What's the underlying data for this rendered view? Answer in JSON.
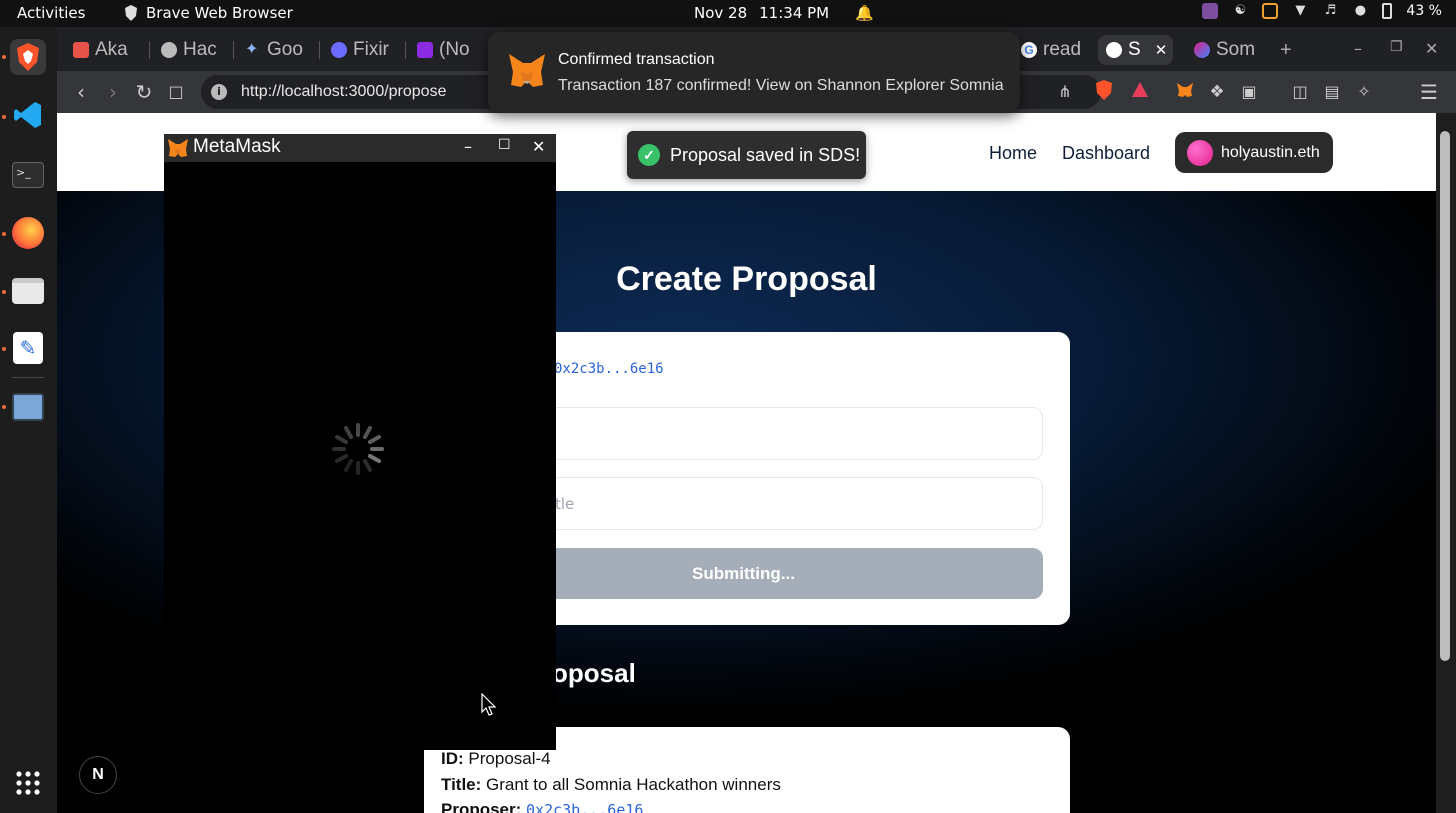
{
  "system": {
    "activities_label": "Activities",
    "app_name": "Brave Web Browser",
    "date": "Nov 28",
    "time": "11:34 PM",
    "battery": "43 %"
  },
  "browser": {
    "tabs": [
      {
        "label": "Aka",
        "favicon_color": "#e5534b"
      },
      {
        "label": "Hac",
        "favicon_color": "#bbbbbb"
      },
      {
        "label": "Goo",
        "favicon_color": "#8ab4f8"
      },
      {
        "label": "Fixir",
        "favicon_color": "#6b6bff"
      },
      {
        "label": "(No",
        "favicon_color": "#8a2be2"
      },
      {
        "label": "read",
        "favicon_color": "#4285f4"
      },
      {
        "label": "S",
        "favicon_color": "#ffffff"
      },
      {
        "label": "Som",
        "favicon_color": "#e0218a"
      }
    ],
    "new_tab_label": "+",
    "url": "http://localhost:3000/propose"
  },
  "notification": {
    "title": "Confirmed transaction",
    "body": "Transaction 187 confirmed! View on Shannon Explorer Somnia"
  },
  "metamask": {
    "title": "MetaMask"
  },
  "site": {
    "nav": {
      "home": "Home",
      "dashboard": "Dashboard"
    },
    "user_name": "holyaustin.eth",
    "toast": "Proposal saved in SDS!",
    "page_title": "Create Proposal",
    "form": {
      "address": "0x2c3b...6e16",
      "title_placeholder": "tle",
      "submit_label": "Submitting..."
    },
    "latest_section_title": "oposal",
    "latest": {
      "id_label": "ID:",
      "id_value": "Proposal-4",
      "title_label": "Title:",
      "title_value": "Grant to all Somnia Hackathon winners",
      "proposer_label": "Proposer:",
      "proposer_value": "0x2c3b...6e16"
    },
    "next_badge": "N"
  },
  "colors": {
    "accent_blue": "#2b63d6",
    "success_green": "#3ac26b",
    "submit_disabled": "#a5adb8"
  }
}
